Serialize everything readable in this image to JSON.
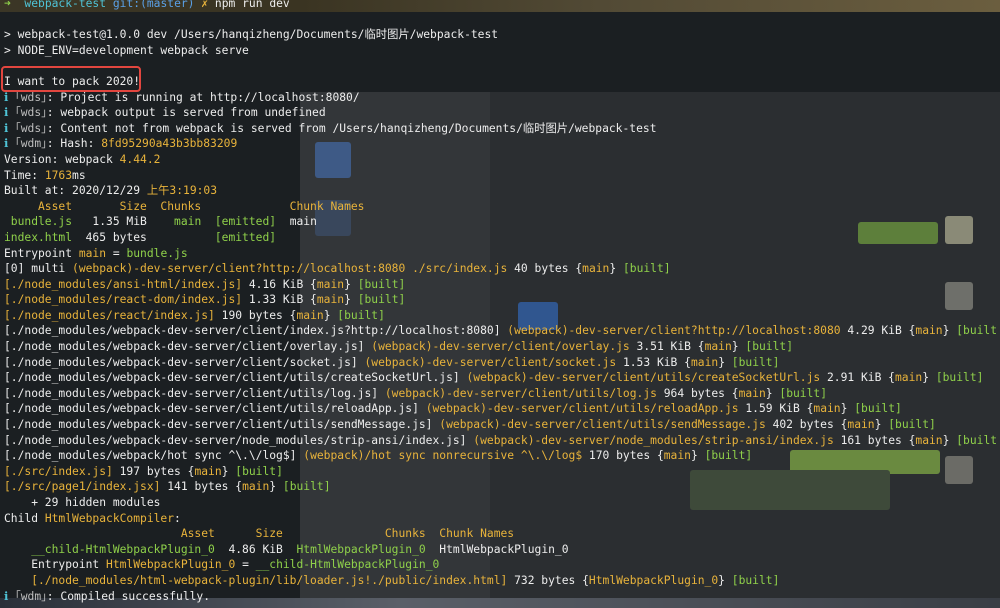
{
  "prompt": {
    "arrow": "➜",
    "dir": "webpack-test",
    "git": "git:(master)",
    "mark": "✗",
    "command": "npm run dev"
  },
  "lines": [
    [],
    [
      {
        "t": "> webpack-test@1.0.0 dev /Users/hanqizheng/Documents/临时图片/webpack-test",
        "c": "w"
      }
    ],
    [
      {
        "t": "> NODE_ENV=development webpack serve",
        "c": "w"
      }
    ],
    [],
    [
      {
        "t": "I want to pack 2020!",
        "c": "w"
      }
    ],
    [
      {
        "t": "ℹ ",
        "c": "c"
      },
      {
        "t": "｢wds｣",
        "c": "d"
      },
      {
        "t": ": Project is running at http://localhost:8080/",
        "c": "w"
      }
    ],
    [
      {
        "t": "ℹ ",
        "c": "c"
      },
      {
        "t": "｢wds｣",
        "c": "d"
      },
      {
        "t": ": webpack output is served from undefined",
        "c": "w"
      }
    ],
    [
      {
        "t": "ℹ ",
        "c": "c"
      },
      {
        "t": "｢wds｣",
        "c": "d"
      },
      {
        "t": ": Content not from webpack is served from /Users/hanqizheng/Documents/临时图片/webpack-test",
        "c": "w"
      }
    ],
    [
      {
        "t": "ℹ ",
        "c": "c"
      },
      {
        "t": "｢wdm｣",
        "c": "d"
      },
      {
        "t": ": Hash: ",
        "c": "w"
      },
      {
        "t": "8fd95290a43b3bb83209",
        "c": "y"
      }
    ],
    [
      {
        "t": "Version: webpack ",
        "c": "w"
      },
      {
        "t": "4.44.2",
        "c": "y"
      }
    ],
    [
      {
        "t": "Time: ",
        "c": "w"
      },
      {
        "t": "1763",
        "c": "y"
      },
      {
        "t": "ms",
        "c": "w"
      }
    ],
    [
      {
        "t": "Built at: 2020/12/29 ",
        "c": "w"
      },
      {
        "t": "上午3:19:03",
        "c": "y"
      }
    ],
    [
      {
        "t": "     Asset       Size  Chunks             Chunk Names",
        "c": "y"
      }
    ],
    [
      {
        "t": " bundle.js",
        "c": "g"
      },
      {
        "t": "   1.35 MiB    ",
        "c": "w"
      },
      {
        "t": "main",
        "c": "g"
      },
      {
        "t": "  ",
        "c": "w"
      },
      {
        "t": "[emitted]",
        "c": "g"
      },
      {
        "t": "  main",
        "c": "w"
      }
    ],
    [
      {
        "t": "index.html",
        "c": "g"
      },
      {
        "t": "  465 bytes          ",
        "c": "w"
      },
      {
        "t": "[emitted]",
        "c": "g"
      }
    ],
    [
      {
        "t": "Entrypoint ",
        "c": "w"
      },
      {
        "t": "main",
        "c": "y"
      },
      {
        "t": " = ",
        "c": "w"
      },
      {
        "t": "bundle.js",
        "c": "g"
      }
    ],
    [
      {
        "t": "[0] multi ",
        "c": "w"
      },
      {
        "t": "(webpack)-dev-server/client?http://localhost:8080 ./src/index.js",
        "c": "y"
      },
      {
        "t": " 40 bytes {",
        "c": "w"
      },
      {
        "t": "main",
        "c": "y"
      },
      {
        "t": "} ",
        "c": "w"
      },
      {
        "t": "[built]",
        "c": "g"
      }
    ],
    [
      {
        "t": "[./node_modules/ansi-html/index.js]",
        "c": "y"
      },
      {
        "t": " 4.16 KiB {",
        "c": "w"
      },
      {
        "t": "main",
        "c": "y"
      },
      {
        "t": "} ",
        "c": "w"
      },
      {
        "t": "[built]",
        "c": "g"
      }
    ],
    [
      {
        "t": "[./node_modules/react-dom/index.js]",
        "c": "y"
      },
      {
        "t": " 1.33 KiB {",
        "c": "w"
      },
      {
        "t": "main",
        "c": "y"
      },
      {
        "t": "} ",
        "c": "w"
      },
      {
        "t": "[built]",
        "c": "g"
      }
    ],
    [
      {
        "t": "[./node_modules/react/index.js]",
        "c": "y"
      },
      {
        "t": " 190 bytes {",
        "c": "w"
      },
      {
        "t": "main",
        "c": "y"
      },
      {
        "t": "} ",
        "c": "w"
      },
      {
        "t": "[built]",
        "c": "g"
      }
    ],
    [
      {
        "t": "[./node_modules/webpack-dev-server/client/index.js?http://localhost:8080] ",
        "c": "w"
      },
      {
        "t": "(webpack)-dev-server/client?http://localhost:8080",
        "c": "y"
      },
      {
        "t": " 4.29 KiB {",
        "c": "w"
      },
      {
        "t": "main",
        "c": "y"
      },
      {
        "t": "} ",
        "c": "w"
      },
      {
        "t": "[built]",
        "c": "g"
      }
    ],
    [
      {
        "t": "[./node_modules/webpack-dev-server/client/overlay.js] ",
        "c": "w"
      },
      {
        "t": "(webpack)-dev-server/client/overlay.js",
        "c": "y"
      },
      {
        "t": " 3.51 KiB {",
        "c": "w"
      },
      {
        "t": "main",
        "c": "y"
      },
      {
        "t": "} ",
        "c": "w"
      },
      {
        "t": "[built]",
        "c": "g"
      }
    ],
    [
      {
        "t": "[./node_modules/webpack-dev-server/client/socket.js] ",
        "c": "w"
      },
      {
        "t": "(webpack)-dev-server/client/socket.js",
        "c": "y"
      },
      {
        "t": " 1.53 KiB {",
        "c": "w"
      },
      {
        "t": "main",
        "c": "y"
      },
      {
        "t": "} ",
        "c": "w"
      },
      {
        "t": "[built]",
        "c": "g"
      }
    ],
    [
      {
        "t": "[./node_modules/webpack-dev-server/client/utils/createSocketUrl.js] ",
        "c": "w"
      },
      {
        "t": "(webpack)-dev-server/client/utils/createSocketUrl.js",
        "c": "y"
      },
      {
        "t": " 2.91 KiB {",
        "c": "w"
      },
      {
        "t": "main",
        "c": "y"
      },
      {
        "t": "} ",
        "c": "w"
      },
      {
        "t": "[built]",
        "c": "g"
      }
    ],
    [
      {
        "t": "[./node_modules/webpack-dev-server/client/utils/log.js] ",
        "c": "w"
      },
      {
        "t": "(webpack)-dev-server/client/utils/log.js",
        "c": "y"
      },
      {
        "t": " 964 bytes {",
        "c": "w"
      },
      {
        "t": "main",
        "c": "y"
      },
      {
        "t": "} ",
        "c": "w"
      },
      {
        "t": "[built]",
        "c": "g"
      }
    ],
    [
      {
        "t": "[./node_modules/webpack-dev-server/client/utils/reloadApp.js] ",
        "c": "w"
      },
      {
        "t": "(webpack)-dev-server/client/utils/reloadApp.js",
        "c": "y"
      },
      {
        "t": " 1.59 KiB {",
        "c": "w"
      },
      {
        "t": "main",
        "c": "y"
      },
      {
        "t": "} ",
        "c": "w"
      },
      {
        "t": "[built]",
        "c": "g"
      }
    ],
    [
      {
        "t": "[./node_modules/webpack-dev-server/client/utils/sendMessage.js] ",
        "c": "w"
      },
      {
        "t": "(webpack)-dev-server/client/utils/sendMessage.js",
        "c": "y"
      },
      {
        "t": " 402 bytes {",
        "c": "w"
      },
      {
        "t": "main",
        "c": "y"
      },
      {
        "t": "} ",
        "c": "w"
      },
      {
        "t": "[built]",
        "c": "g"
      }
    ],
    [
      {
        "t": "[./node_modules/webpack-dev-server/node_modules/strip-ansi/index.js] ",
        "c": "w"
      },
      {
        "t": "(webpack)-dev-server/node_modules/strip-ansi/index.js",
        "c": "y"
      },
      {
        "t": " 161 bytes {",
        "c": "w"
      },
      {
        "t": "main",
        "c": "y"
      },
      {
        "t": "} ",
        "c": "w"
      },
      {
        "t": "[built]",
        "c": "g"
      }
    ],
    [
      {
        "t": "[./node_modules/webpack/hot sync ^\\.\\/log$] ",
        "c": "w"
      },
      {
        "t": "(webpack)/hot sync nonrecursive ^\\.\\/log$",
        "c": "y"
      },
      {
        "t": " 170 bytes {",
        "c": "w"
      },
      {
        "t": "main",
        "c": "y"
      },
      {
        "t": "} ",
        "c": "w"
      },
      {
        "t": "[built]",
        "c": "g"
      }
    ],
    [
      {
        "t": "[./src/index.js]",
        "c": "y"
      },
      {
        "t": " 197 bytes {",
        "c": "w"
      },
      {
        "t": "main",
        "c": "y"
      },
      {
        "t": "} ",
        "c": "w"
      },
      {
        "t": "[built]",
        "c": "g"
      }
    ],
    [
      {
        "t": "[./src/page1/index.jsx]",
        "c": "y"
      },
      {
        "t": " 141 bytes {",
        "c": "w"
      },
      {
        "t": "main",
        "c": "y"
      },
      {
        "t": "} ",
        "c": "w"
      },
      {
        "t": "[built]",
        "c": "g"
      }
    ],
    [
      {
        "t": "    + 29 hidden modules",
        "c": "w"
      }
    ],
    [
      {
        "t": "Child ",
        "c": "w"
      },
      {
        "t": "HtmlWebpackCompiler",
        "c": "y"
      },
      {
        "t": ":",
        "c": "w"
      }
    ],
    [
      {
        "t": "                          Asset      Size               Chunks  Chunk Names",
        "c": "y"
      }
    ],
    [
      {
        "t": "    __child-HtmlWebpackPlugin_0",
        "c": "g"
      },
      {
        "t": "  4.86 KiB  ",
        "c": "w"
      },
      {
        "t": "HtmlWebpackPlugin_0",
        "c": "g"
      },
      {
        "t": "  HtmlWebpackPlugin_0",
        "c": "w"
      }
    ],
    [
      {
        "t": "    Entrypoint ",
        "c": "w"
      },
      {
        "t": "HtmlWebpackPlugin_0",
        "c": "y"
      },
      {
        "t": " = ",
        "c": "w"
      },
      {
        "t": "__child-HtmlWebpackPlugin_0",
        "c": "g"
      }
    ],
    [
      {
        "t": "    [./node_modules/html-webpack-plugin/lib/loader.js!./public/index.html]",
        "c": "y"
      },
      {
        "t": " 732 bytes {",
        "c": "w"
      },
      {
        "t": "HtmlWebpackPlugin_0",
        "c": "y"
      },
      {
        "t": "} ",
        "c": "w"
      },
      {
        "t": "[built]",
        "c": "g"
      }
    ],
    [
      {
        "t": "ℹ ",
        "c": "c"
      },
      {
        "t": "｢wdm｣",
        "c": "d"
      },
      {
        "t": ": Compiled successfully.",
        "c": "w"
      }
    ]
  ]
}
